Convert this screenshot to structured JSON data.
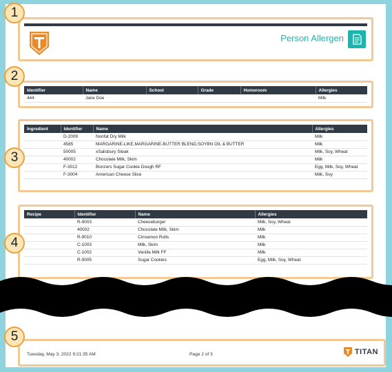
{
  "callouts": [
    "1",
    "2",
    "3",
    "4",
    "5"
  ],
  "header": {
    "title": "Person Allergen",
    "logo_icon": "shield-t-logo",
    "report_icon": "report-document-icon",
    "brand_color": "#1ab6ad",
    "logo_color": "#e98b2a"
  },
  "person": {
    "headers": [
      "Identifier",
      "Name",
      "School",
      "Grade",
      "Homeroom",
      "Allergies"
    ],
    "rows": [
      [
        "444",
        "Jane Doe",
        "",
        "",
        "",
        "Milk"
      ]
    ]
  },
  "ingredients": {
    "headers": [
      "Ingredient",
      "Identifier",
      "Name",
      "Allergies"
    ],
    "rows": [
      [
        "",
        "D-2009",
        "Nonfat Dry Milk",
        "Milk"
      ],
      [
        "",
        "4585",
        "MARGARINE-LIKE,MARGARINE-BUTTER BLEND,SOYBN OIL & BUTTER",
        "Milk"
      ],
      [
        "",
        "50005",
        "xSalisbury Steak",
        "Milk, Soy, Wheat"
      ],
      [
        "",
        "40002",
        "Chocolate Milk, Skim",
        "Milk"
      ],
      [
        "",
        "F-3012",
        "Bonzers Sugar Cookie Dough RF",
        "Egg, Milk, Soy, Wheat"
      ],
      [
        "",
        "F-3004",
        "American Cheese Slice",
        "Milk, Soy"
      ]
    ]
  },
  "recipes": {
    "headers": [
      "Recipe",
      "Identifier",
      "Name",
      "Allergies"
    ],
    "rows": [
      [
        "",
        "R-9003",
        "Cheeseburger",
        "Milk, Soy, Wheat"
      ],
      [
        "",
        "40002",
        "Chocolate Milk, Skim",
        "Milk"
      ],
      [
        "",
        "R-9010",
        "Cinnamon Rolls",
        "Milk"
      ],
      [
        "",
        "C-1003",
        "Milk, Skim",
        "Milk"
      ],
      [
        "",
        "C-1002",
        "Vanilla Milk FF",
        "Milk"
      ],
      [
        "",
        "R-9005",
        "Sugar Cookies",
        "Egg, Milk, Soy, Wheat"
      ]
    ]
  },
  "footer": {
    "date": "Tuesday, May 3, 2022 9:21:35 AM",
    "page": "Page 2 of 3",
    "logo_text": "TITAN"
  }
}
